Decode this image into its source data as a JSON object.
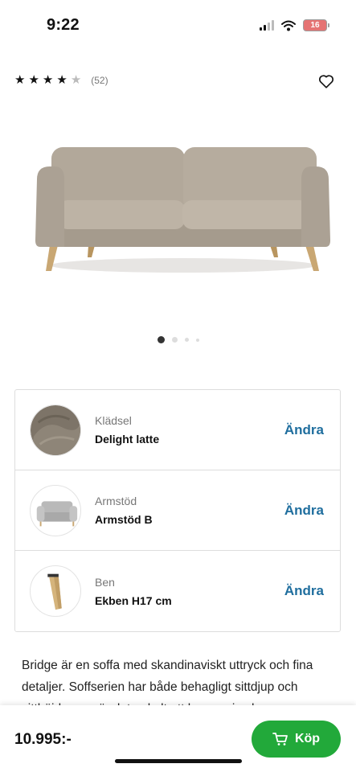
{
  "status_bar": {
    "time": "9:22",
    "battery": "16"
  },
  "product": {
    "rating_value": 4.5,
    "rating_max": 5,
    "review_count": "(52)",
    "price": "10.995:-",
    "buy_label": "Köp",
    "description": "Bridge är en soffa med skandinaviskt uttryck och fina detaljer. Soffserien har både behagligt sittdjup och sitthöjd som gör det enkelt att komma i och ur"
  },
  "carousel": {
    "count": 4,
    "active_index": 0
  },
  "options": [
    {
      "label": "Klädsel",
      "value": "Delight latte",
      "action": "Ändra",
      "thumb_icon": "fabric-swatch-icon"
    },
    {
      "label": "Armstöd",
      "value": "Armstöd B",
      "action": "Ändra",
      "thumb_icon": "armchair-icon"
    },
    {
      "label": "Ben",
      "value": "Ekben H17 cm",
      "action": "Ändra",
      "thumb_icon": "wooden-leg-icon"
    }
  ],
  "colors": {
    "accent_blue": "#1f6e9e",
    "buy_green": "#22a93a",
    "fabric": "#b4aa9c"
  }
}
